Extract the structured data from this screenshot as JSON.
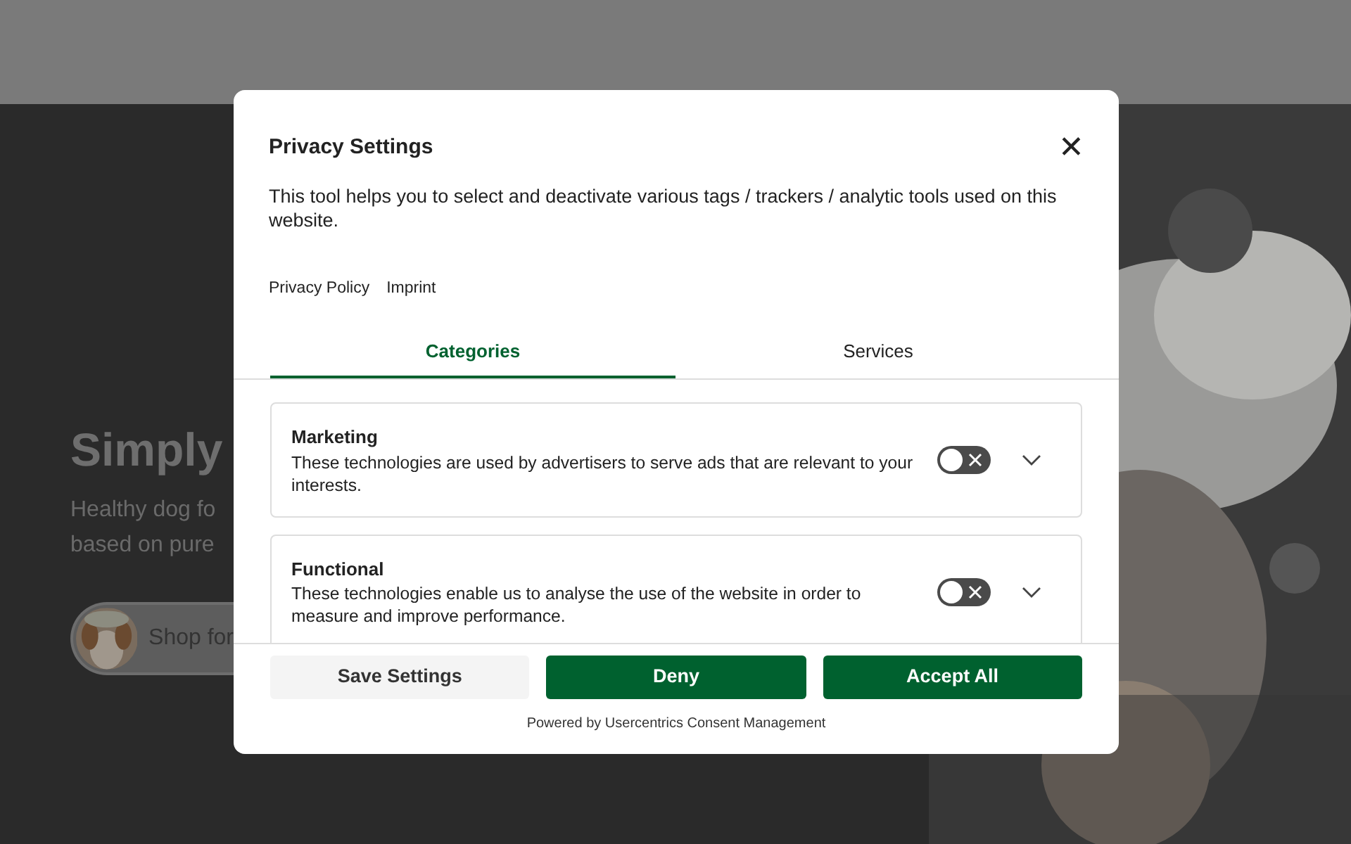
{
  "hero": {
    "title": "Simply",
    "subtitle_lines": [
      "Healthy dog fo",
      "based on pure"
    ],
    "shop_button": "Shop for"
  },
  "dialog": {
    "title": "Privacy Settings",
    "close": "✕",
    "description": "This tool helps you to select and deactivate various tags / trackers / analytic tools used on this website.",
    "links": [
      "Privacy Policy",
      "Imprint"
    ],
    "tabs": [
      {
        "label": "Categories",
        "selected": true
      },
      {
        "label": "Services",
        "selected": false
      }
    ],
    "categories": [
      {
        "name": "Marketing",
        "description": "These technologies are used by advertisers to serve ads that are relevant to your interests.",
        "on": false,
        "expanded": false
      },
      {
        "name": "Functional",
        "description": "These technologies enable us to analyse the use of the website in order to measure and improve performance.",
        "on": false,
        "expanded": false
      }
    ],
    "buttons": [
      {
        "label": "Save Settings",
        "kind": "secondary"
      },
      {
        "label": "Deny",
        "kind": "primary"
      },
      {
        "label": "Accept All",
        "kind": "primary"
      }
    ],
    "footer": "Powered by Usercentrics Consent Management"
  }
}
